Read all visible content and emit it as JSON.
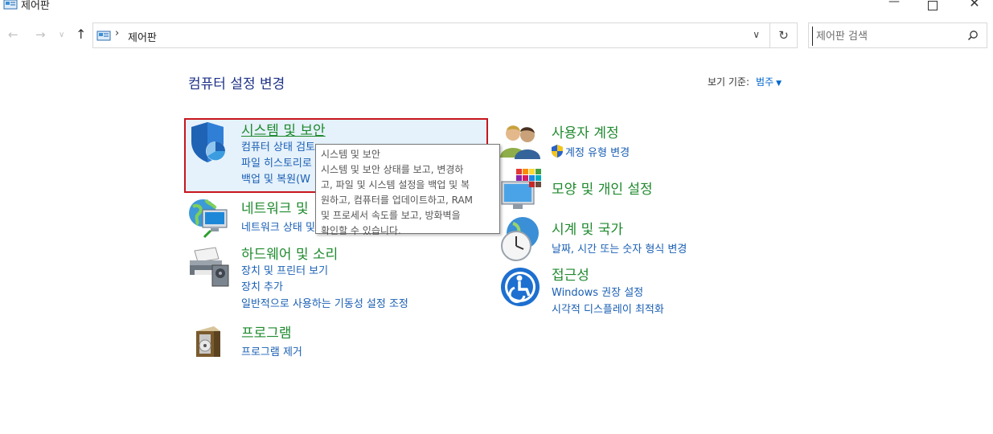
{
  "window": {
    "title": "제어판",
    "minimize": "—",
    "close": "✕"
  },
  "nav": {
    "back": "←",
    "forward": "→",
    "recent": "∨",
    "up": "↑",
    "separator": "›",
    "breadcrumb": "제어판",
    "dropdown": "∨",
    "refresh": "↻"
  },
  "search": {
    "placeholder": "제어판 검색"
  },
  "page": {
    "title": "컴퓨터 설정 변경",
    "view_by_label": "보기 기준:",
    "view_by_value": "범주",
    "view_by_caret": "▼"
  },
  "categories": {
    "system_security": {
      "title": "시스템 및 보안",
      "links": [
        "컴퓨터 상태 검토",
        "파일 히스토리로",
        "백업 및 복원(W"
      ]
    },
    "network": {
      "title": "네트워크 및",
      "links": [
        "네트워크 상태 및"
      ]
    },
    "hardware": {
      "title": "하드웨어 및 소리",
      "links": [
        "장치 및 프린터 보기",
        "장치 추가",
        "일반적으로 사용하는 기동성 설정 조정"
      ]
    },
    "programs": {
      "title": "프로그램",
      "links": [
        "프로그램 제거"
      ]
    },
    "user_accounts": {
      "title": "사용자 계정",
      "links": [
        "계정 유형 변경"
      ]
    },
    "appearance": {
      "title": "모양 및 개인 설정",
      "links": []
    },
    "clock_region": {
      "title": "시계 및 국가",
      "links": [
        "날짜, 시간 또는 숫자 형식 변경"
      ]
    },
    "ease_access": {
      "title": "접근성",
      "links": [
        "Windows 권장 설정",
        "시각적 디스플레이 최적화"
      ]
    }
  },
  "tooltip": {
    "lines": [
      "시스템 및 보안",
      "시스템 및 보안 상태를 보고, 변경하",
      "고, 파일 및 시스템 설정을 백업 및 복",
      "원하고, 컴퓨터를 업데이트하고, RAM",
      "및 프로세서 속도를 보고, 방화벽을",
      "확인할 수 있습니다."
    ]
  },
  "colors": {
    "category_title": "#1f8a2e",
    "link": "#1a5fb4",
    "page_title": "#1e3287",
    "selection_border": "#c8161d",
    "selection_fill": "#e5f1fb"
  },
  "icons": {
    "app": "control-panel-icon",
    "search": "magnifier-icon",
    "system_security": "shield-icon",
    "network": "globe-network-icon",
    "hardware": "printer-icon",
    "programs": "program-box-icon",
    "user_accounts": "users-icon",
    "uac": "uac-shield-icon",
    "appearance": "monitor-palette-icon",
    "clock_region": "clock-globe-icon",
    "ease_access": "accessibility-icon"
  }
}
